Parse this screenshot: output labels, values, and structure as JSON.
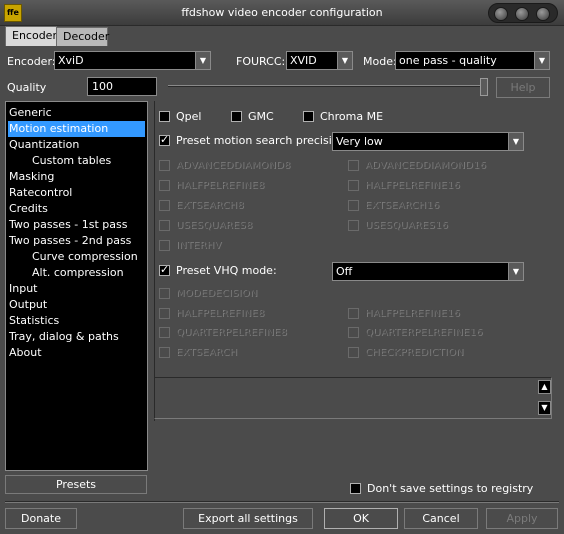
{
  "window": {
    "title": "ffdshow video encoder configuration",
    "icon_text": "ffe"
  },
  "tabs": [
    {
      "label": "Encoder",
      "active": true
    },
    {
      "label": "Decoder",
      "active": false
    }
  ],
  "encoder_row": {
    "encoder_label": "Encoder:",
    "encoder_value": "XviD",
    "fourcc_label": "FOURCC:",
    "fourcc_value": "XVID",
    "mode_label": "Mode:",
    "mode_value": "one pass - quality"
  },
  "quality": {
    "label": "Quality",
    "value": "100",
    "slider_fraction": 1.0,
    "help_label": "Help"
  },
  "tree": {
    "items": [
      {
        "label": "Generic",
        "selected": false,
        "indent": false
      },
      {
        "label": "Motion estimation",
        "selected": true,
        "indent": false
      },
      {
        "label": "Quantization",
        "selected": false,
        "indent": false
      },
      {
        "label": "Custom tables",
        "selected": false,
        "indent": true
      },
      {
        "label": "Masking",
        "selected": false,
        "indent": false
      },
      {
        "label": "Ratecontrol",
        "selected": false,
        "indent": false
      },
      {
        "label": "Credits",
        "selected": false,
        "indent": false
      },
      {
        "label": "Two passes - 1st pass",
        "selected": false,
        "indent": false
      },
      {
        "label": "Two passes - 2nd pass",
        "selected": false,
        "indent": false
      },
      {
        "label": "Curve compression",
        "selected": false,
        "indent": true
      },
      {
        "label": "Alt. compression",
        "selected": false,
        "indent": true
      },
      {
        "label": "Input",
        "selected": false,
        "indent": false
      },
      {
        "label": "Output",
        "selected": false,
        "indent": false
      },
      {
        "label": "Statistics",
        "selected": false,
        "indent": false
      },
      {
        "label": "Tray, dialog & paths",
        "selected": false,
        "indent": false
      },
      {
        "label": "About",
        "selected": false,
        "indent": false
      }
    ],
    "presets_label": "Presets"
  },
  "motion": {
    "qpel_label": "Qpel",
    "gmc_label": "GMC",
    "chroma_me_label": "Chroma ME",
    "preset_search_label": "Preset motion search precision:",
    "preset_search_value": "Very low",
    "search_flags": {
      "advanceddiamond8": "ADVANCEDDIAMOND8",
      "advanceddiamond16": "ADVANCEDDIAMOND16",
      "halfpelrefine8": "HALFPELREFINE8",
      "halfpelrefine16": "HALFPELREFINE16",
      "extsearch8": "EXTSEARCH8",
      "extsearch16": "EXTSEARCH16",
      "usesquares8": "USESQUARES8",
      "usesquares16": "USESQUARES16",
      "interhv": "INTERHV"
    },
    "preset_vhq_label": "Preset VHQ mode:",
    "preset_vhq_value": "Off",
    "vhq_flags": {
      "modedecision": "MODEDECISION",
      "halfpelrefine8": "HALFPELREFINE8",
      "halfpelrefine16": "HALFPELREFINE16",
      "quarterpelrefine8": "QUARTERPELREFINE8",
      "quarterpelrefine16": "QUARTERPELREFINE16",
      "extsearch": "EXTSEARCH",
      "checkprediction": "CHECKPREDICTION"
    }
  },
  "dont_save_label": "Don't save settings to registry",
  "bottom": {
    "donate": "Donate",
    "export": "Export all settings",
    "ok": "OK",
    "cancel": "Cancel",
    "apply": "Apply"
  }
}
